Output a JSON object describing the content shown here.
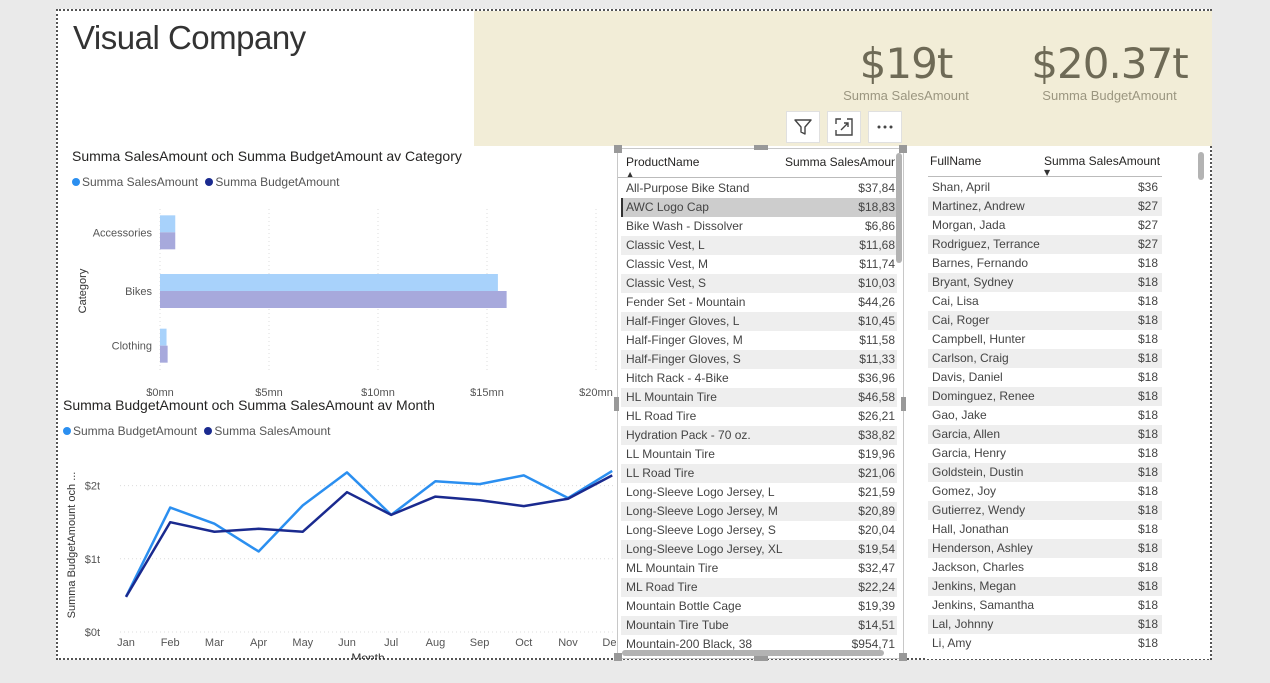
{
  "report_title": "Visual Company",
  "kpis": [
    {
      "value": "$19t",
      "label": "Summa SalesAmount"
    },
    {
      "value": "$20.37t",
      "label": "Summa BudgetAmount"
    }
  ],
  "visual_header_icons": [
    "filter-icon",
    "focus-mode-icon",
    "more-options-icon"
  ],
  "bar_chart": {
    "title": "Summa SalesAmount och Summa BudgetAmount av Category",
    "legend": [
      "Summa SalesAmount",
      "Summa BudgetAmount"
    ],
    "ylabel": "Category",
    "x_ticks": [
      "$0mn",
      "$5mn",
      "$10mn",
      "$15mn",
      "$20mn"
    ]
  },
  "line_chart": {
    "title": "Summa BudgetAmount och Summa SalesAmount av Month",
    "legend": [
      "Summa BudgetAmount",
      "Summa SalesAmount"
    ],
    "ylabel": "Summa BudgetAmount och ...",
    "xlabel": "Month",
    "y_ticks": [
      "$2t",
      "$1t",
      "$0t"
    ]
  },
  "chart_data": [
    {
      "type": "bar",
      "orientation": "horizontal",
      "title": "Summa SalesAmount och Summa BudgetAmount av Category",
      "ylabel": "Category",
      "xlabel": "",
      "categories": [
        "Accessories",
        "Bikes",
        "Clothing"
      ],
      "series": [
        {
          "name": "Summa SalesAmount",
          "values": [
            0.7,
            15.5,
            0.3
          ],
          "color": "#a8d2fb"
        },
        {
          "name": "Summa BudgetAmount",
          "values": [
            0.7,
            15.9,
            0.35
          ],
          "color": "#a7a9dc"
        }
      ],
      "xlim": [
        0,
        20
      ],
      "legend_position": "top-left",
      "grid": true
    },
    {
      "type": "line",
      "title": "Summa BudgetAmount och Summa SalesAmount av Month",
      "xlabel": "Month",
      "ylabel": "Summa BudgetAmount och ...",
      "categories": [
        "Jan",
        "Feb",
        "Mar",
        "Apr",
        "May",
        "Jun",
        "Jul",
        "Aug",
        "Sep",
        "Oct",
        "Nov",
        "Dec"
      ],
      "series": [
        {
          "name": "Summa BudgetAmount",
          "values": [
            0.48,
            1.7,
            1.48,
            1.1,
            1.73,
            2.18,
            1.6,
            2.06,
            2.02,
            2.14,
            1.83,
            2.2
          ],
          "color": "#2b8ff0"
        },
        {
          "name": "Summa SalesAmount",
          "values": [
            0.48,
            1.5,
            1.37,
            1.41,
            1.37,
            1.91,
            1.6,
            1.85,
            1.8,
            1.72,
            1.82,
            2.14
          ],
          "color": "#1a2a8f"
        }
      ],
      "ylim": [
        0,
        2.5
      ],
      "legend_position": "top-left",
      "grid": true
    }
  ],
  "product_table": {
    "headers": [
      "ProductName",
      "Summa SalesAmoun"
    ],
    "rows": [
      [
        "All-Purpose Bike Stand",
        "$37,84"
      ],
      [
        "AWC Logo Cap",
        "$18,83"
      ],
      [
        "Bike Wash - Dissolver",
        "$6,86"
      ],
      [
        "Classic Vest, L",
        "$11,68"
      ],
      [
        "Classic Vest, M",
        "$11,74"
      ],
      [
        "Classic Vest, S",
        "$10,03"
      ],
      [
        "Fender Set - Mountain",
        "$44,26"
      ],
      [
        "Half-Finger Gloves, L",
        "$10,45"
      ],
      [
        "Half-Finger Gloves, M",
        "$11,58"
      ],
      [
        "Half-Finger Gloves, S",
        "$11,33"
      ],
      [
        "Hitch Rack - 4-Bike",
        "$36,96"
      ],
      [
        "HL Mountain Tire",
        "$46,58"
      ],
      [
        "HL Road Tire",
        "$26,21"
      ],
      [
        "Hydration Pack - 70 oz.",
        "$38,82"
      ],
      [
        "LL Mountain Tire",
        "$19,96"
      ],
      [
        "LL Road Tire",
        "$21,06"
      ],
      [
        "Long-Sleeve Logo Jersey, L",
        "$21,59"
      ],
      [
        "Long-Sleeve Logo Jersey, M",
        "$20,89"
      ],
      [
        "Long-Sleeve Logo Jersey, S",
        "$20,04"
      ],
      [
        "Long-Sleeve Logo Jersey, XL",
        "$19,54"
      ],
      [
        "ML Mountain Tire",
        "$32,47"
      ],
      [
        "ML Road Tire",
        "$22,24"
      ],
      [
        "Mountain Bottle Cage",
        "$19,39"
      ],
      [
        "Mountain Tire Tube",
        "$14,51"
      ],
      [
        "Mountain-200 Black, 38",
        "$954,71"
      ]
    ]
  },
  "customer_table": {
    "headers": [
      "FullName",
      "Summa SalesAmount"
    ],
    "rows": [
      [
        "Shan, April",
        "$36"
      ],
      [
        "Martinez, Andrew",
        "$27"
      ],
      [
        "Morgan, Jada",
        "$27"
      ],
      [
        "Rodriguez, Terrance",
        "$27"
      ],
      [
        "Barnes, Fernando",
        "$18"
      ],
      [
        "Bryant, Sydney",
        "$18"
      ],
      [
        "Cai, Lisa",
        "$18"
      ],
      [
        "Cai, Roger",
        "$18"
      ],
      [
        "Campbell, Hunter",
        "$18"
      ],
      [
        "Carlson, Craig",
        "$18"
      ],
      [
        "Davis, Daniel",
        "$18"
      ],
      [
        "Dominguez, Renee",
        "$18"
      ],
      [
        "Gao, Jake",
        "$18"
      ],
      [
        "Garcia, Allen",
        "$18"
      ],
      [
        "Garcia, Henry",
        "$18"
      ],
      [
        "Goldstein, Dustin",
        "$18"
      ],
      [
        "Gomez, Joy",
        "$18"
      ],
      [
        "Gutierrez, Wendy",
        "$18"
      ],
      [
        "Hall, Jonathan",
        "$18"
      ],
      [
        "Henderson, Ashley",
        "$18"
      ],
      [
        "Jackson, Charles",
        "$18"
      ],
      [
        "Jenkins, Megan",
        "$18"
      ],
      [
        "Jenkins, Samantha",
        "$18"
      ],
      [
        "Lal, Johnny",
        "$18"
      ],
      [
        "Li, Amy",
        "$18"
      ]
    ]
  },
  "colors": {
    "kpi_background": "#f2edd7",
    "kpi_text": "#6e6a56",
    "sales_light": "#a8d2fb",
    "budget_light": "#a7a9dc",
    "line_budget": "#2b8ff0",
    "line_sales": "#1a2a8f"
  }
}
